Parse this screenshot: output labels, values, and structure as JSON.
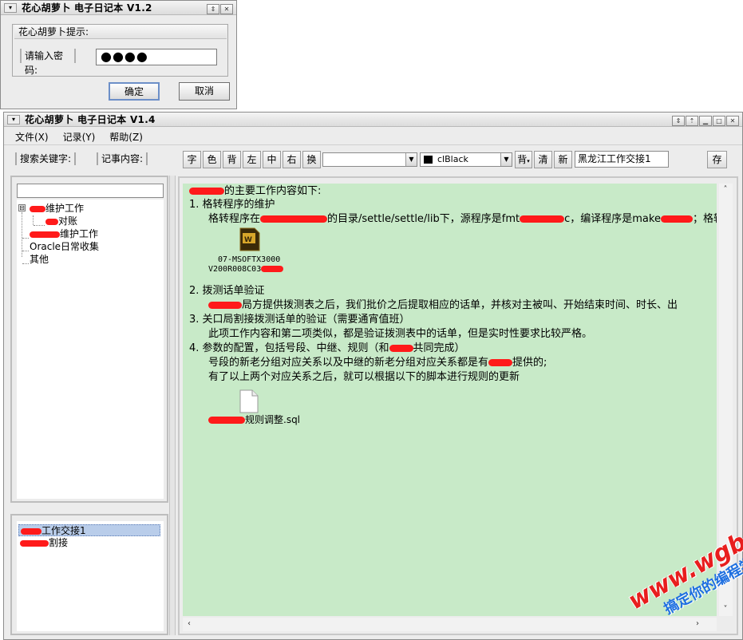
{
  "login": {
    "title": "花心胡萝卜 电子日记本 V1.2",
    "section_title": "花心胡萝卜提示:",
    "password_label": "请输入密码:",
    "password_value": "●●●●",
    "ok_label": "确定",
    "cancel_label": "取消"
  },
  "main": {
    "title": "花心胡萝卜 电子日记本 V1.4",
    "menu": [
      {
        "label": "文件(X)"
      },
      {
        "label": "记录(Y)"
      },
      {
        "label": "帮助(Z)"
      }
    ],
    "toolbar": {
      "search_label": "搜索关键字:",
      "content_label": "记事内容:",
      "buttons": [
        "字",
        "色",
        "背",
        "左",
        "中",
        "右",
        "换"
      ],
      "font_combo_value": "",
      "color_combo_value": "clBlack",
      "bg_button": "背",
      "clear_button": "清",
      "new_button": "新",
      "title_field_value": "黑龙江工作交接1",
      "save_button": "存"
    },
    "tree": {
      "search_value": "",
      "nodes": [
        {
          "label": "维护工作",
          "expander": "⊟"
        },
        {
          "label": "对账"
        },
        {
          "label": "维护工作"
        },
        {
          "label": "Oracle日常收集"
        },
        {
          "label": "其他"
        }
      ]
    },
    "list": {
      "items": [
        {
          "label": "工作交接1"
        },
        {
          "label": "割接"
        }
      ]
    },
    "editor": {
      "lines": [
        "的主要工作内容如下:",
        "1.          格转程序的维护",
        "格转程序在",
        "的目录/settle/settle/lib下，源程序是fmt",
        "c，编译程序是make",
        "；格转程",
        "2.          拨测话单验证",
        "局方提供拨测表之后，我们批价之后提取相应的话单，并核对主被叫、开始结束时间、时长、出",
        "3.          关口局割接拨测话单的验证（需要通宵值班）",
        "此项工作内容和第二项类似，都是验证拨测表中的话单，但是实时性要求比较严格。",
        "4.          参数的配置，包括号段、中继、规则（和",
        "共同完成）",
        "号段的新老分组对应关系以及中继的新老分组对应关系都是有",
        "提供的;",
        "有了以上两个对应关系之后，就可以根据以下的脚本进行规则的更新"
      ],
      "attachment1_caption_line1": "07-MSOFTX3000",
      "attachment1_caption_line2": "V200R008C03",
      "attachment2_caption": "规则调整.sql"
    },
    "watermark": {
      "line1": "www.wgbcw.com",
      "line2": "搞定你的编程学习网"
    }
  }
}
